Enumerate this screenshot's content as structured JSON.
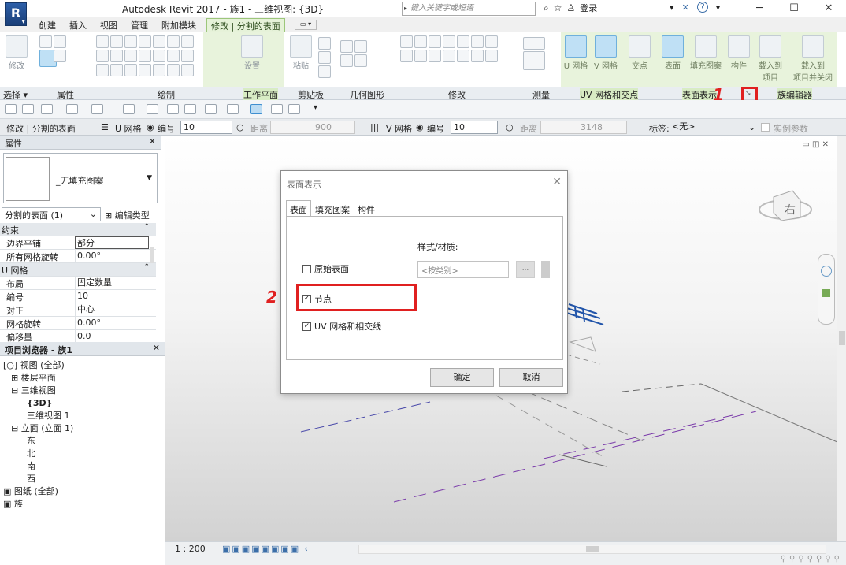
{
  "titlebar": {
    "app_letter": "R",
    "title": "Autodesk Revit 2017 -    族1 - 三维视图: {3D}",
    "search_placeholder": "键入关键字或短语",
    "login": "登录",
    "min": "─",
    "max": "☐",
    "close": "✕"
  },
  "ribbon_tabs": [
    "创建",
    "插入",
    "视图",
    "管理",
    "附加模块",
    "修改 | 分割的表面"
  ],
  "ribbon": {
    "modify": "修改",
    "settings": "设置",
    "paste": "粘贴",
    "u_grid": "U 网格",
    "v_grid": "V 网格",
    "intersect": "交点",
    "surface": "表面",
    "fill_pattern": "填充图案",
    "component": "构件",
    "load_project": "载入到\n项目",
    "load_close": "载入到\n项目并关闭"
  },
  "panel_labels": {
    "select": "选择 ▾",
    "properties": "属性",
    "draw": "绘制",
    "workplane": "工作平面",
    "clipboard": "剪贴板",
    "geometry": "几何图形",
    "modify": "修改",
    "measure": "测量",
    "uvgrid": "UV 网格和交点",
    "surface_rep": "表面表示",
    "family_editor": "族编辑器"
  },
  "annotations": {
    "one": "1",
    "two": "2"
  },
  "optbar": {
    "context": "修改 | 分割的表面",
    "u_grid": "U 网格",
    "number": "编号",
    "u_number": "10",
    "distance": "距离",
    "u_distance": "900",
    "v_grid": "V 网格",
    "v_number": "10",
    "v_distance": "3148",
    "label": "标签:",
    "label_value": "<无>",
    "instance_param": "实例参数"
  },
  "properties": {
    "title": "属性",
    "type_name": "_无填充图案",
    "instance": "分割的表面 (1)",
    "edit_type": "编辑类型",
    "rows": [
      {
        "k": "约束",
        "v": "",
        "group": true
      },
      {
        "k": "边界平铺",
        "v": "部分",
        "group": false
      },
      {
        "k": "所有网格旋转",
        "v": "0.00°",
        "group": false
      },
      {
        "k": "U 网格",
        "v": "",
        "group": true
      },
      {
        "k": "布局",
        "v": "固定数量",
        "group": false
      },
      {
        "k": "编号",
        "v": "10",
        "group": false
      },
      {
        "k": "对正",
        "v": "中心",
        "group": false
      },
      {
        "k": "网格旋转",
        "v": "0.00°",
        "group": false
      },
      {
        "k": "偏移量",
        "v": "0.0",
        "group": false
      }
    ]
  },
  "browser": {
    "title": "项目浏览器 - 族1",
    "items": [
      {
        "label": "[○] 视图 (全部)",
        "indent": 0,
        "bold": false
      },
      {
        "label": "⊞ 楼层平面",
        "indent": 1,
        "bold": false
      },
      {
        "label": "⊟ 三维视图",
        "indent": 1,
        "bold": false
      },
      {
        "label": "{3D}",
        "indent": 3,
        "bold": true
      },
      {
        "label": "三维视图 1",
        "indent": 3,
        "bold": false
      },
      {
        "label": "⊟ 立面 (立面 1)",
        "indent": 1,
        "bold": false
      },
      {
        "label": "东",
        "indent": 3,
        "bold": false
      },
      {
        "label": "北",
        "indent": 3,
        "bold": false
      },
      {
        "label": "南",
        "indent": 3,
        "bold": false
      },
      {
        "label": "西",
        "indent": 3,
        "bold": false
      },
      {
        "label": "▣ 图纸 (全部)",
        "indent": 0,
        "bold": false
      },
      {
        "label": "▣ 族",
        "indent": 0,
        "bold": false
      }
    ]
  },
  "viewport": {
    "controls": "▭ ◫ ✕",
    "viewcube_label": "右"
  },
  "status": {
    "scale": "1 : 200"
  },
  "dialog": {
    "title": "表面表示",
    "tabs": [
      "表面",
      "填充图案",
      "构件"
    ],
    "style_label": "样式/材质:",
    "cb_original": "原始表面",
    "cb_nodes": "节点",
    "cb_uvgrid": "UV 网格和相交线",
    "material_placeholder": "<按类别>",
    "dots": "...",
    "ok": "确定",
    "cancel": "取消"
  }
}
